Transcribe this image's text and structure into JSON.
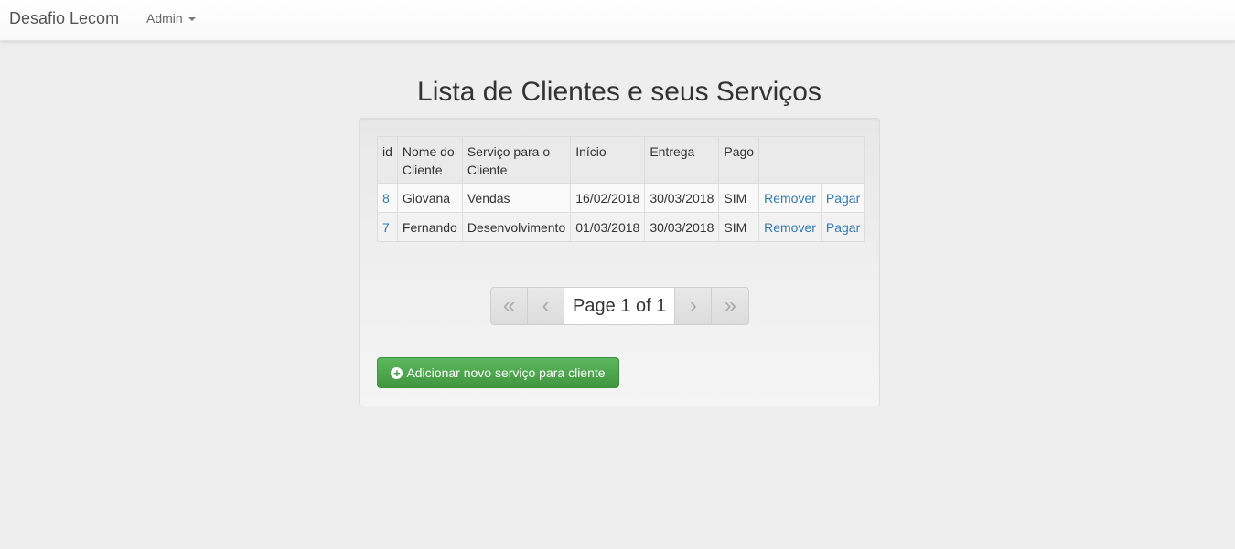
{
  "navbar": {
    "brand": "Desafio Lecom",
    "admin_label": "Admin"
  },
  "main": {
    "title": "Lista de Clientes e seus Serviços"
  },
  "table": {
    "headers": [
      "id",
      "Nome do Cliente",
      "Serviço para o Cliente",
      "Início",
      "Entrega",
      "Pago",
      ""
    ],
    "rows": [
      {
        "id": "8",
        "nome": "Giovana",
        "servico": "Vendas",
        "inicio": "16/02/2018",
        "entrega": "30/03/2018",
        "pago": "SIM",
        "remover": "Remover",
        "pagar": "Pagar"
      },
      {
        "id": "7",
        "nome": "Fernando",
        "servico": "Desenvolvimento",
        "inicio": "01/03/2018",
        "entrega": "30/03/2018",
        "pago": "SIM",
        "remover": "Remover",
        "pagar": "Pagar"
      }
    ]
  },
  "pager": {
    "first": "«",
    "prev": "‹",
    "info": "Page 1 of 1",
    "next": "›",
    "last": "»"
  },
  "add_button": {
    "label": "Adicionar novo serviço para cliente",
    "icon": "plus-circle-icon"
  },
  "colors": {
    "accent": "#337ab7",
    "button_green": "#5cb85c"
  }
}
